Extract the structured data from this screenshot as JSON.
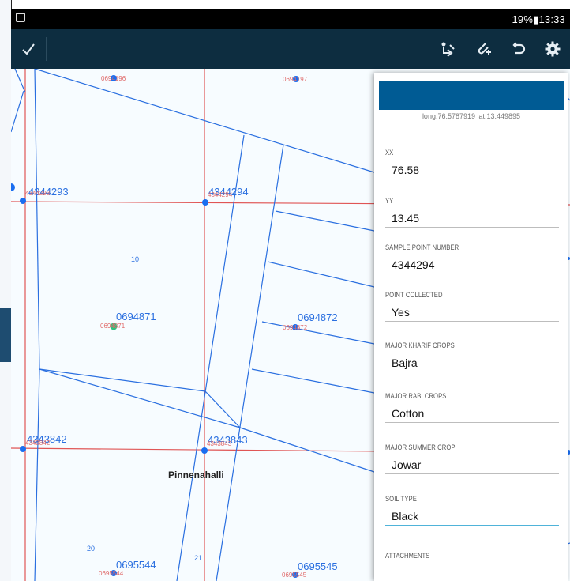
{
  "status_bar": {
    "right_text": "19%▮13:33"
  },
  "toolbar": {
    "confirm_icon": "check-icon",
    "icons": [
      "route-icon",
      "attach-icon",
      "undo-icon",
      "gear-icon"
    ]
  },
  "map": {
    "points": [
      {
        "id": "4344293",
        "sub": "4344293"
      },
      {
        "id": "4344294",
        "sub": "4344294"
      },
      {
        "id": "0694871",
        "sub": "0694871",
        "color": "#2ec27e"
      },
      {
        "id": "0694872",
        "sub": "0694872"
      },
      {
        "id": "4343842",
        "sub": "4343842"
      },
      {
        "id": "4343843",
        "sub": "4343843"
      },
      {
        "id": "0695544",
        "sub": "0695544"
      },
      {
        "id": "0695545",
        "sub": "0695545"
      },
      {
        "id": "",
        "sub": "0694196"
      },
      {
        "id": "",
        "sub": "0694197"
      }
    ],
    "parcel_numbers": [
      "10",
      "20",
      "21"
    ],
    "village_label": "Pinnenahalli",
    "colors": {
      "grid": "#e05555",
      "parcel": "#2a6fe0",
      "point": "#1a6ef0"
    }
  },
  "panel": {
    "coords_text": "long:76.5787919 lat:13.449895",
    "fields": [
      {
        "label": "XX",
        "value": "76.58"
      },
      {
        "label": "YY",
        "value": "13.45"
      },
      {
        "label": "SAMPLE POINT NUMBER",
        "value": "4344294"
      },
      {
        "label": "POINT COLLECTED",
        "value": "Yes"
      },
      {
        "label": "MAJOR KHARIF CROPS",
        "value": "Bajra"
      },
      {
        "label": "MAJOR RABI CROPS",
        "value": "Cotton"
      },
      {
        "label": "MAJOR SUMMER CROP",
        "value": "Jowar"
      },
      {
        "label": "SOIL TYPE",
        "value": "Black"
      }
    ],
    "attachments_label": "ATTACHMENTS",
    "accent_color": "#005b94"
  }
}
